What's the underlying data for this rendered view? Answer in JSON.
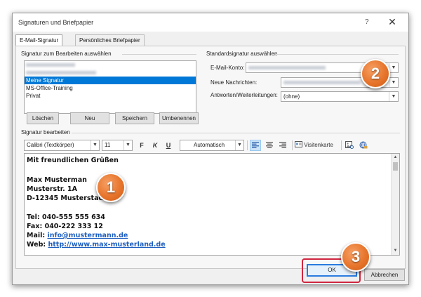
{
  "window": {
    "title": "Signaturen und Briefpapier",
    "help_glyph": "?",
    "close_glyph": "✕"
  },
  "tabs": [
    {
      "label": "E-Mail-Signatur",
      "active": true
    },
    {
      "label": "Persönliches Briefpapier",
      "active": false
    }
  ],
  "select_group": {
    "label": "Signatur zum Bearbeiten auswählen",
    "items": [
      {
        "label": "",
        "blurred": true
      },
      {
        "label": "",
        "blurred": true
      },
      {
        "label": "Meine Signatur",
        "selected": true
      },
      {
        "label": "MS-Office-Training",
        "selected": false
      },
      {
        "label": "Privat",
        "selected": false
      }
    ],
    "buttons": {
      "delete": "Löschen",
      "new": "Neu",
      "save": "Speichern",
      "rename": "Umbenennen"
    }
  },
  "default_group": {
    "label": "Standardsignatur auswählen",
    "email_label": "E-Mail-Konto:",
    "new_messages_label": "Neue Nachrichten:",
    "replies_label": "Antworten/Weiterleitungen:",
    "replies_value": "(ohne)"
  },
  "edit_group": {
    "label": "Signatur bearbeiten",
    "font_value": "Calibri (Textkörper)",
    "size_value": "11",
    "bold_label": "F",
    "italic_label": "K",
    "underline_label": "U",
    "color_value": "Automatisch",
    "business_card_label": "Visitenkarte"
  },
  "signature": {
    "greeting": "Mit freundlichen Grüßen",
    "name": "Max Musterman",
    "street": "Musterstr. 1A",
    "city": "D-12345 Musterstadt",
    "phone": "Tel: 040-555 555 634",
    "fax": "Fax: 040-222 333 12",
    "mail_prefix": "Mail: ",
    "mail_link": "info@mustermann.de",
    "web_prefix": "Web: ",
    "web_link": "http://www.max-musterland.de"
  },
  "footer": {
    "ok": "OK",
    "cancel": "Abbrechen"
  },
  "callouts": [
    "1",
    "2",
    "3"
  ],
  "colors": {
    "selection": "#0078d7",
    "callout": "#e7752c",
    "highlight": "#d1253e",
    "link": "#1f5fbf"
  }
}
